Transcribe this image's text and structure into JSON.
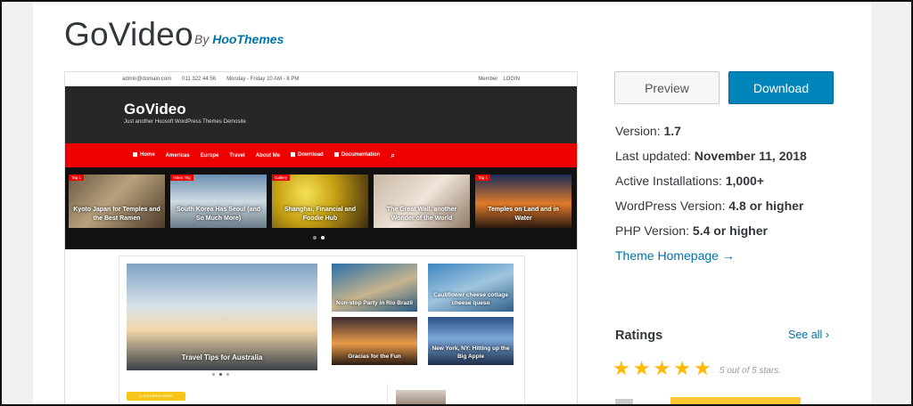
{
  "header": {
    "title": "GoVideo",
    "by": "By",
    "author": "HooThemes"
  },
  "mock": {
    "topbar": {
      "email": "admin@domain.com",
      "phone": "011 322 44 56",
      "hours": "Monday - Friday 10 AM - 8 PM",
      "member": "Member",
      "login": "LOGIN"
    },
    "site_title": "GoVideo",
    "tagline": "Just another Hoosoft WordPress Themes Demosite",
    "nav": [
      "Home",
      "Americas",
      "Europe",
      "Travel",
      "About Me",
      "Download",
      "Documentation"
    ],
    "slides": [
      {
        "label": "Kyoto Japan for Temples and the Best Ramen",
        "badge": "Tag 1"
      },
      {
        "label": "South Korea Has Seoul (and So Much More)",
        "badge": "Video Tag"
      },
      {
        "label": "Shanghai, Financial and Foodie Hub",
        "badge": "Gallery"
      },
      {
        "label": "The Great Wall, another Wonder of the World",
        "badge": ""
      },
      {
        "label": "Temples on Land and in Water",
        "badge": "Tag 1"
      }
    ],
    "featured": "Travel Tips for Australia",
    "minis": [
      "Non-stop Party in Rio Brazil",
      "Cauliflower cheese cottage cheese queso",
      "Gracias for the Fun",
      "New York, NY: Hitting up the Big Apple"
    ],
    "pill": "● FEATURED VIDEO"
  },
  "actions": {
    "preview": "Preview",
    "download": "Download"
  },
  "meta": {
    "version_label": "Version:",
    "version": "1.7",
    "updated_label": "Last updated:",
    "updated": "November 11, 2018",
    "installs_label": "Active Installations:",
    "installs": "1,000+",
    "wp_label": "WordPress Version:",
    "wp": "4.8 or higher",
    "php_label": "PHP Version:",
    "php": "5.4 or higher",
    "homepage": "Theme Homepage →"
  },
  "ratings": {
    "heading": "Ratings",
    "see_all": "See all ›",
    "stars": 5,
    "note": "5 out of 5 stars."
  },
  "colors": {
    "accent": "#0085ba",
    "link": "#0073aa",
    "star": "#ffb900",
    "nav_red": "#e00000"
  }
}
